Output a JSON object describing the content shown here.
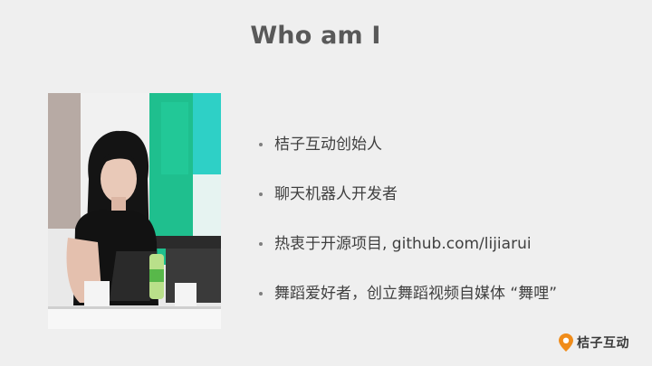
{
  "slide": {
    "title": "Who am I"
  },
  "bullets": [
    {
      "text": "桔子互动创始人"
    },
    {
      "text": "聊天机器人开发者"
    },
    {
      "text": "热衷于开源项目, github.com/lijiarui"
    },
    {
      "text": "舞蹈爱好者，创立舞蹈视频自媒体 “舞哩”"
    }
  ],
  "logo": {
    "text": "桔子互动",
    "color": "#f08c1a"
  },
  "colors": {
    "background": "#efefef",
    "title": "#595959",
    "text": "#404040"
  }
}
